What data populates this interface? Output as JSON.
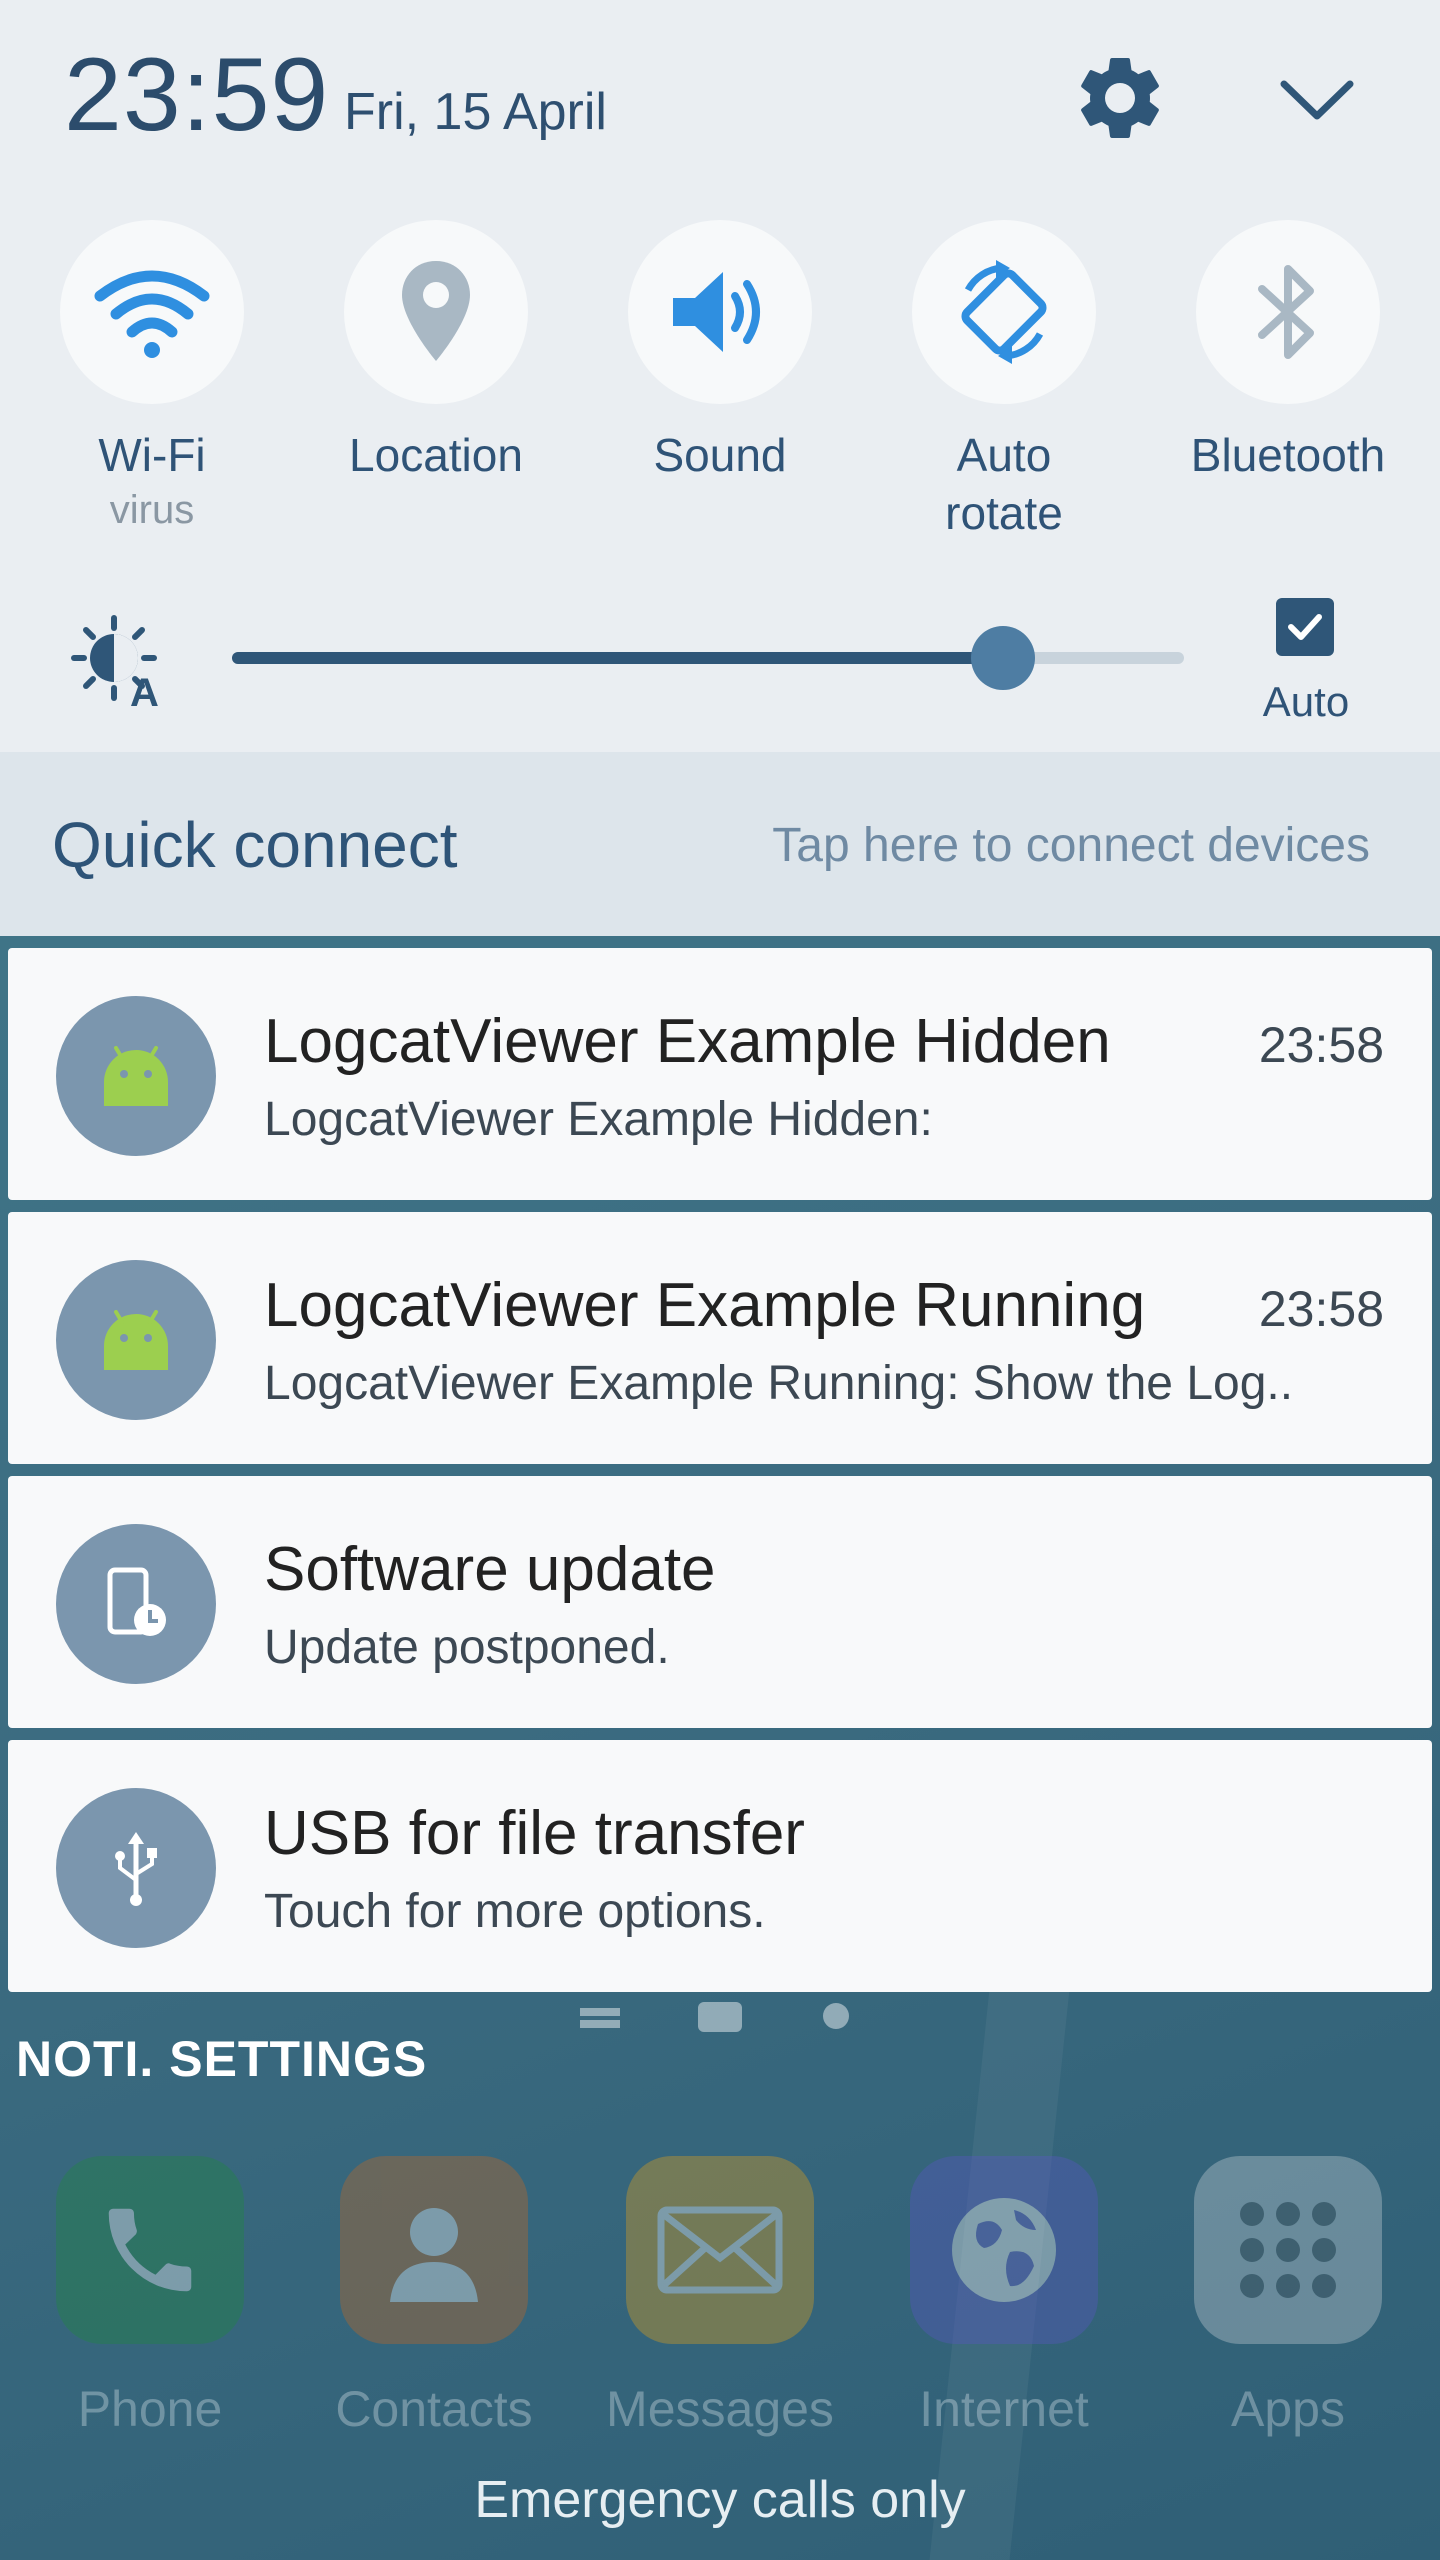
{
  "status": {
    "time": "23:59",
    "date": "Fri, 15 April"
  },
  "quick_toggles": [
    {
      "label": "Wi-Fi",
      "sub": "virus",
      "icon": "wifi-icon",
      "active": true
    },
    {
      "label": "Location",
      "sub": "",
      "icon": "location-icon",
      "active": false
    },
    {
      "label": "Sound",
      "sub": "",
      "icon": "sound-icon",
      "active": true
    },
    {
      "label": "Auto\nrotate",
      "sub": "",
      "icon": "auto-rotate-icon",
      "active": true
    },
    {
      "label": "Bluetooth",
      "sub": "",
      "icon": "bluetooth-icon",
      "active": false
    }
  ],
  "brightness": {
    "level": 0.81,
    "auto_checked": true,
    "auto_label": "Auto"
  },
  "quick_connect": {
    "title": "Quick connect",
    "hint": "Tap here to connect devices"
  },
  "notifications": [
    {
      "title": "LogcatViewer Example Hidden",
      "text": "LogcatViewer Example Hidden:",
      "time": "23:58",
      "icon": "android-icon"
    },
    {
      "title": "LogcatViewer Example Running",
      "text": "LogcatViewer Example Running: Show the Log..",
      "time": "23:58",
      "icon": "android-icon"
    },
    {
      "title": "Software update",
      "text": "Update postponed.",
      "time": "",
      "icon": "software-update-icon"
    },
    {
      "title": "USB for file transfer",
      "text": "Touch for more options.",
      "time": "",
      "icon": "usb-icon"
    }
  ],
  "noti_settings_label": "NOTI. SETTINGS",
  "dock": [
    {
      "label": "Phone",
      "icon": "phone-icon"
    },
    {
      "label": "Contacts",
      "icon": "contacts-icon"
    },
    {
      "label": "Messages",
      "icon": "messages-icon"
    },
    {
      "label": "Internet",
      "icon": "internet-icon"
    },
    {
      "label": "Apps",
      "icon": "apps-grid-icon"
    }
  ],
  "emergency_text": "Emergency calls only",
  "colors": {
    "accent": "#2f8fe0",
    "panel_bg": "#eaeef2",
    "header_text": "#2c4c6c",
    "notif_icon_bg": "#7b96ae",
    "inactive_icon": "#a9b8c4"
  }
}
